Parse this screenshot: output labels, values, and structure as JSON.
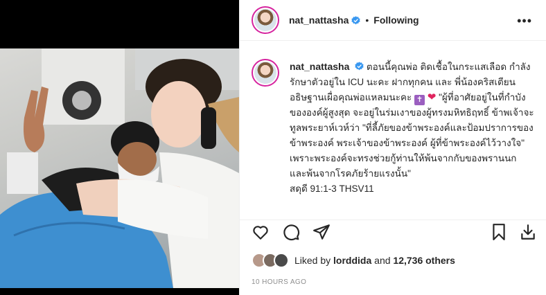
{
  "post": {
    "username": "nat_nattasha",
    "separator": "•",
    "follow_status": "Following",
    "more_label": "•••"
  },
  "caption": {
    "username": "nat_nattasha",
    "part1": "ตอนนี้คุณพ่อ ติดเชื้อในกระแสเลือด กำลังรักษาตัวอยู่ใน ICU นะคะ ฝากทุกคน และ พี่น้องคริสเตียน อธิษฐานเผื่อคุณพ่อแหลมนะคะ",
    "emoji_cross": "✝",
    "emoji_heart": "❤",
    "part2": "\"ผู้ที่อาศัยอยู่ในที่กำบังขององค์ผู้สูงสุด จะอยู่ในร่มเงาของผู้ทรงมหิทธิฤทธิ์ ข้าพเจ้าจะทูลพระยาห์เวห์ว่า \"ที่ลี้ภัยของข้าพระองค์และป้อมปราการของข้าพระองค์ พระเจ้าของข้าพระองค์ ผู้ที่ข้าพระองค์ไว้วางใจ\" เพราะพระองค์จะทรงช่วยกู้ท่านให้พ้นจากกับของพรานนก และพ้นจากโรคภัยร้ายแรงนั้น\"",
    "reference": "สดุดี 91:1-3 THSV11"
  },
  "likes": {
    "prefix": "Liked by ",
    "user": "lorddida",
    "connector": " and ",
    "count": "12,736 others"
  },
  "timestamp": "10 HOURS AGO",
  "icons": [
    "heart-icon",
    "comment-icon",
    "share-icon",
    "bookmark-icon",
    "download-icon",
    "verified-badge-icon",
    "more-options-icon"
  ],
  "colors": {
    "verified": "#3897f0",
    "text": "#262626",
    "muted": "#8e8e8e",
    "story_ring": "#d6249f"
  }
}
